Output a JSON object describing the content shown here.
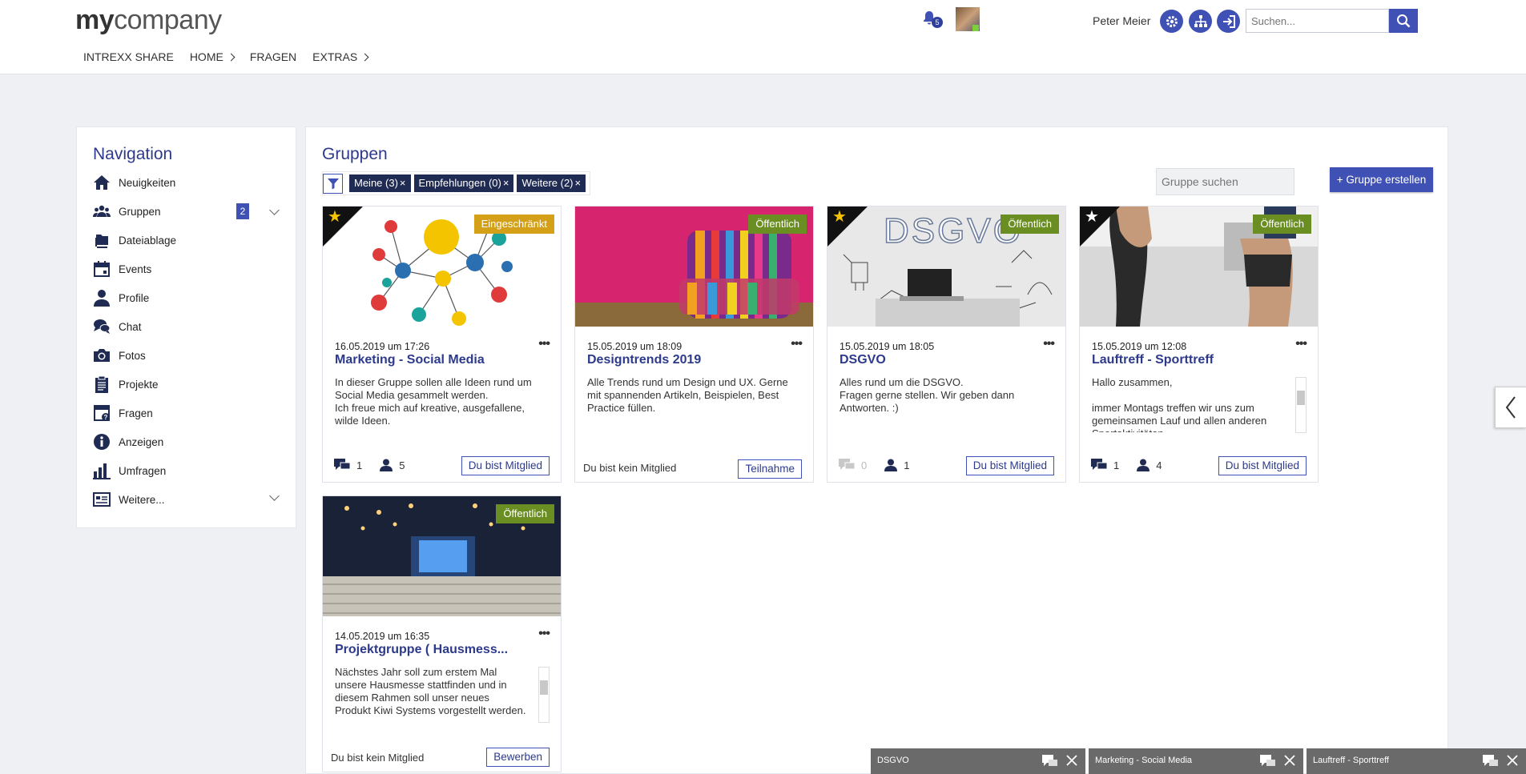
{
  "header": {
    "logo_bold": "my",
    "logo_rest": "company",
    "nav": [
      "INTREXX SHARE",
      "HOME",
      "FRAGEN",
      "EXTRAS"
    ],
    "notifications_count": "5",
    "user_name": "Peter Meier",
    "search_placeholder": "Suchen..."
  },
  "sidebar": {
    "title": "Navigation",
    "items": [
      {
        "label": "Neuigkeiten",
        "icon": "home-icon"
      },
      {
        "label": "Gruppen",
        "icon": "group-icon",
        "badge": "2"
      },
      {
        "label": "Dateiablage",
        "icon": "files-icon"
      },
      {
        "label": "Events",
        "icon": "calendar-icon"
      },
      {
        "label": "Profile",
        "icon": "person-icon"
      },
      {
        "label": "Chat",
        "icon": "chat-icon"
      },
      {
        "label": "Fotos",
        "icon": "camera-icon"
      },
      {
        "label": "Projekte",
        "icon": "clipboard-icon"
      },
      {
        "label": "Fragen",
        "icon": "question-icon"
      },
      {
        "label": "Anzeigen",
        "icon": "info-icon"
      },
      {
        "label": "Umfragen",
        "icon": "bar-chart-icon"
      },
      {
        "label": "Weitere...",
        "icon": "list-icon"
      }
    ]
  },
  "main": {
    "title": "Gruppen",
    "filters": [
      "Meine (3)",
      "Empfehlungen (0)",
      "Weitere (2)"
    ],
    "filter_close": "×",
    "search_placeholder": "Gruppe suchen",
    "create_label": "+ Gruppe erstellen"
  },
  "cards": [
    {
      "date": "16.05.2019 um 17:26",
      "title": "Marketing - Social Media",
      "tag": "Eingeschränkt",
      "desc": "In dieser Gruppe sollen alle Ideen rund um Social Media gesammelt werden.\nIch freue mich auf kreative, ausgefallene, wilde Ideen.",
      "comments": "1",
      "members": "5",
      "action": "Du bist Mitglied"
    },
    {
      "date": "15.05.2019 um 18:09",
      "title": "Designtrends 2019",
      "tag": "Öffentlich",
      "desc": "Alle Trends rund um Design und UX. Gerne mit spannenden Artikeln, Beispielen, Best Practice füllen.",
      "status": "Du bist kein Mitglied",
      "action": "Teilnahme"
    },
    {
      "date": "15.05.2019 um 18:05",
      "title": "DSGVO",
      "tag": "Öffentlich",
      "desc": "Alles rund um die DSGVO.\nFragen gerne stellen. Wir geben dann Antworten. :)",
      "comments": "0",
      "members": "1",
      "action": "Du bist Mitglied"
    },
    {
      "date": "15.05.2019 um 12:08",
      "title": "Lauftreff - Sporttreff",
      "tag": "Öffentlich",
      "desc": "Hallo zusammen,\n\nimmer Montags treffen wir uns zum gemeinsamen Lauf und allen anderen Sportaktivitäten.",
      "comments": "1",
      "members": "4",
      "action": "Du bist Mitglied"
    },
    {
      "date": "14.05.2019 um 16:35",
      "title": "Projektgruppe ( Hausmess...",
      "tag": "Öffentlich",
      "desc": "Nächstes Jahr soll zum erstem Mal unsere Hausmesse stattfinden und in diesem Rahmen soll unser neues Produkt Kiwi Systems vorgestellt werden.",
      "status": "Du bist kein Mitglied",
      "action": "Bewerben"
    }
  ],
  "chats": [
    "DSGVO",
    "Marketing - Social Media",
    "Lauftreff - Sporttreff"
  ],
  "colors": {
    "accent": "#3f51b5",
    "title": "#2d3a8c",
    "tag_public": "#6b8e23",
    "tag_restricted": "#d4a017"
  }
}
